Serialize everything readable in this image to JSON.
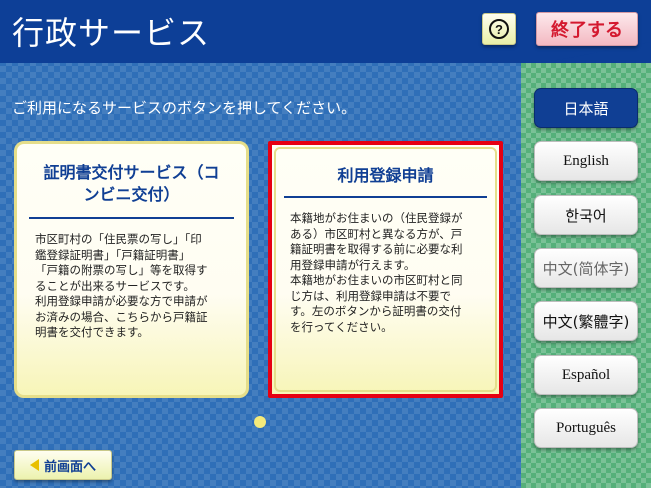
{
  "header": {
    "title": "行政サービス",
    "help_label": "?",
    "end_label": "終了する"
  },
  "instruction": "ご利用になるサービスのボタンを押してください。",
  "cards": [
    {
      "title_lines": [
        "証明書交付サービス（コ",
        "ンビニ交付）"
      ],
      "body_lines": [
        "市区町村の「住民票の写し」「印",
        "鑑登録証明書」「戸籍証明書」",
        "「戸籍の附票の写し」等を取得す",
        "ることが出来るサービスです。",
        "利用登録申請が必要な方で申請が",
        "お済みの場合、こちらから戸籍証",
        "明書を交付できます。"
      ]
    },
    {
      "title_lines": [
        "利用登録申請"
      ],
      "body_lines": [
        "本籍地がお住まいの（住民登録が",
        "ある）市区町村と異なる方が、戸",
        "籍証明書を取得する前に必要な利",
        "用登録申請が行えます。",
        "本籍地がお住まいの市区町村と同",
        "じ方は、利用登録申請は不要で",
        "す。左のボタンから証明書の交付",
        "を行ってください。"
      ]
    }
  ],
  "languages": [
    {
      "label": "日本語",
      "selected": true
    },
    {
      "label": "English"
    },
    {
      "label": "한국어"
    },
    {
      "label": "中文(简体字)"
    },
    {
      "label": "中文(繁體字)"
    },
    {
      "label": "Español"
    },
    {
      "label": "Português"
    }
  ],
  "back_label": "前画面へ",
  "colors": {
    "header_blue": "#0d3f97",
    "accent_red": "#e60012",
    "panel_green": "#55b07a",
    "card_yellow": "#f7f5b8"
  }
}
